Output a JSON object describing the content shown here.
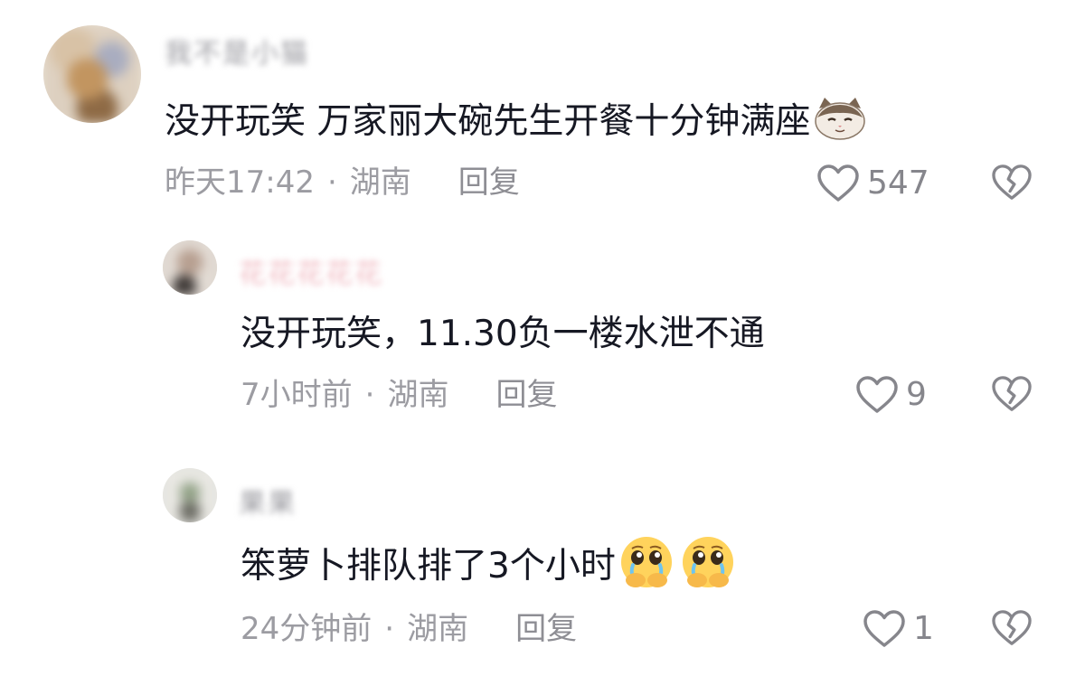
{
  "comments": [
    {
      "username": "我不是小猫",
      "text": "没开玩笑 万家丽大碗先生开餐十分钟满座",
      "emoji_icon": "cat-face-emoji",
      "time": "昨天17:42",
      "separator": "·",
      "location": "湖南",
      "reply_label": "回复",
      "likes": "547"
    },
    {
      "username": "花花花花花",
      "text": "没开玩笑，11.30负一楼水泄不通",
      "time": "7小时前",
      "separator": "·",
      "location": "湖南",
      "reply_label": "回复",
      "likes": "9"
    },
    {
      "username": "果果",
      "text": "笨萝卜排队排了3个小时",
      "emoji_icon": "pleading-face-emoji",
      "time": "24分钟前",
      "separator": "·",
      "location": "湖南",
      "reply_label": "回复",
      "likes": "1"
    }
  ],
  "icons": {
    "like": "heart-outline-icon",
    "dislike": "broken-heart-icon"
  },
  "colors": {
    "text": "#161823",
    "meta": "#9c9ca2",
    "icon": "#86868c",
    "background": "#ffffff"
  }
}
